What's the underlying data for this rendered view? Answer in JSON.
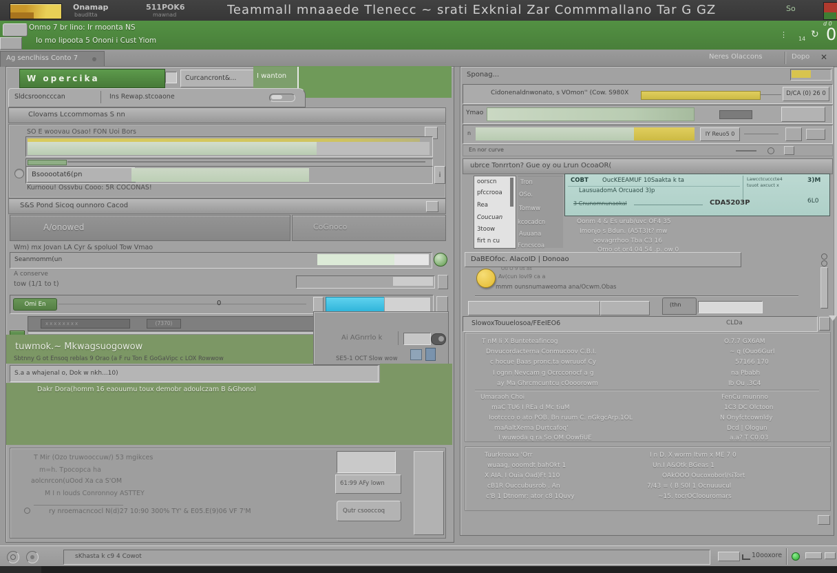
{
  "colors": {
    "accent_green": "#4e8c3f",
    "progress_yellow": "#d8c44e",
    "progress_sage": "#c4d6bc",
    "cyan": "#3fc4e6",
    "teal_box": "#b5d4cc",
    "warning_yellow": "#eec63f",
    "led_green": "#35c73a"
  },
  "titlebar": {
    "menu1_top": "Onamap",
    "menu1_sub": "baudltta",
    "menu2_top": "511POK6",
    "menu2_sub": "mawnad",
    "title": "Teammall mnaaede Tlenecc ~ srati Exknial Zar Commmallano Tar G GZ",
    "right_label": "So"
  },
  "greenbar": {
    "line1": "Onmo 7 br lino: Ir rnoonta NS",
    "line2": "Io mo lipoota 5 Ononi i Cust Yiom",
    "counter": "0",
    "counter_small": "d 0",
    "sub_marks": "14",
    "refresh": "↻",
    "dots": "⋮"
  },
  "menustrip": {
    "tab": "Ag senclhiss Conto 7",
    "right1": "Neres Olaccons",
    "right2": "Dopo",
    "right_icon": "✕"
  },
  "left": {
    "btn_green": "W opercika",
    "field_doc": "Curcancront&...",
    "tab_green": "I wanton",
    "subtab_a": "Sldcsrooncccan",
    "subtab_b": "Ins  Rewap.stcoaone",
    "sec1": "Clovams Lccommomas S nn",
    "grp1_label": "SO E woovau Osao! FON Uoi Bors",
    "grp1_field": "Bsooootat6(pn",
    "grp1_caption": "Kurnoou! Ossvbu Cooo: 5R COCONAS!",
    "sec2": "S&S Pond Sicoq ounnoro Cacod",
    "btn_approved": "A/onowed",
    "btn_cancel": "CoGnoco",
    "lbl_row": "Wm) mx Jovan LA Cyr & spoluol Tow Vmao",
    "field_scan": "Seanmomm(un",
    "line_a": "A conserve",
    "line_b": "tow (1/1 to t)",
    "pill_tag": "Omi En",
    "slider_value": "0",
    "chip1": "xxxxxxxx",
    "chip2": "(7370)",
    "green_title": "tuwmok.~  Mkwagsuogowow",
    "monitor_lbl": "Ai AGnrrlo k",
    "status_l": "Sbtnny G ot Ensoq reblas 9 Orao (a F ru Ton E GoGaVipc c LOX Rowwow",
    "status_r": "SE5-1 OCT Slow wow",
    "field_note": "S.a a whajenal o,  Dok w nkh...10)",
    "caption_note": "Dakr Dora(homm   16 eaouumu toux demobr adoulczam B    &Ghonol",
    "foot": {
      "l1": "T Mir (Ozo truwooccuw/)   53 mgikces",
      "l2": "m=h.   Tpocopca ha",
      "l3": "aolcnrcon(uOod Xa ca S'OM",
      "l4": "M I n louds Conronnoy   ASTTEY",
      "l5": "ry nroemacncocl N(d)27     10:90  300%  TY'  &  E05.E(9)06    VF 7'M",
      "btn_rate": "61:99 AFy lown",
      "btn_quick": "Qutr csooccoq"
    }
  },
  "right": {
    "header": "Sponag...",
    "row1_label": "Cidonenaldnwonato, s VOmon''  (Cow. S980X",
    "row1_value": "D/CA (0) 26 0",
    "row2_label": "Ymao",
    "row3_prefix": "n",
    "row3_label": "IY Reuo5 0",
    "row4_label": "En nor curve",
    "sec": "ubrce Tonrrton? Gue oy ou Lrun OcoaOR(",
    "list1": [
      "oorscn",
      "pfccrooa",
      "Rea",
      "Coucuan",
      "3toow",
      "firt n cu"
    ],
    "list2": [
      "Tron",
      "OSo.",
      "Tomww",
      "kcocadcn",
      "Auuana",
      "Fcncscoa"
    ],
    "teal": {
      "c1": "COBT",
      "c2": "OucKEEAMUF  10Saakta k ta",
      "r2a": "LausuadomA Orcuaod 3)p",
      "r2b": "Lawcctcucccte4",
      "r2c": "tuuot axcuct x",
      "r3a": "3 Cnunomnunaokal",
      "r3b": "CDA5203P",
      "v1": "3)M",
      "v2": "6L0"
    },
    "notes": [
      "Oonm 4 & Es urub/uvc OF4 35",
      "Imonjo s        Bdun.   (A5T3)t? mw",
      "oovagrrhoo   Tba C3 16",
      "Omo ot or4 04 54 .p. ow 0"
    ],
    "diag_title": "DaBEOfoc. AlacoID  |  Donoao",
    "warn0": "Ou O 9 us as",
    "warn1": "Av(cun lovl9   ca a",
    "warn2": "mmm ounsnumaweoma   ana/Ocwm.Obas",
    "mini_tab": "(thn",
    "log_left": "SlowoxTouuelosoa/FEeIEO6",
    "log_right": "CLDa",
    "details": [
      {
        "label": "T nM Ii X Bunteteafincog",
        "value": "O.7.7 GX6AM"
      },
      {
        "label": "Dnvucordacterna Conmucoov C.B.I.",
        "value": "~ q (Ouo6Gurl"
      },
      {
        "label": "c hocue Baas pronc.ta owruuof Cy",
        "value": "57166 170"
      },
      {
        "label": "I ognn Nevcam g Ocrcconocf a g",
        "value": "na Pbabh"
      },
      {
        "label": "ay Ma Ghrcmcuntcu cOooorowm",
        "value": "Ib Ou .3C4"
      },
      {
        "label": "Umaraoh    Choi",
        "value": "FenCu munnno"
      },
      {
        "label": "maC TU6 I REa d Mc tiuM",
        "value": "1C3 DC Olctoon"
      },
      {
        "label": "Iootccco o ato POB. Bn ruum C. nGkgcArp.1OL",
        "value": "N Onyfctcownldy"
      },
      {
        "label": "maAaltXema Durtcafoq'",
        "value": "Dcd | Ologun"
      },
      {
        "label": "I wuwoda q ra   So OM OowfiUE",
        "value": "a.a? T C0.03"
      }
    ],
    "info_left": [
      "Tuurkroaxa      'Orr",
      "wuaag, ooomdt bahOkt 1",
      "X AIA. I Ouia Oad)Ft 110",
      "cB1R Ouccubusrob . An",
      "c'B 1 Dtnomr: ator c8 1Quvy"
    ],
    "info_right": [
      "I n D. X worm Itvm x ME 7 0",
      "Un.I A&Otk BGeas 1",
      "OAkOOO Oucoxoborl/siTort",
      "7/43 = ( B S0l 1 Ocnuuucul",
      "~15.  tocrOCloouromars"
    ]
  },
  "statusbar": {
    "field": "sKhasta k c9 4 Cowot",
    "zoom_label": "10ooxore"
  },
  "icons": {
    "info": "i",
    "dot": "•"
  }
}
